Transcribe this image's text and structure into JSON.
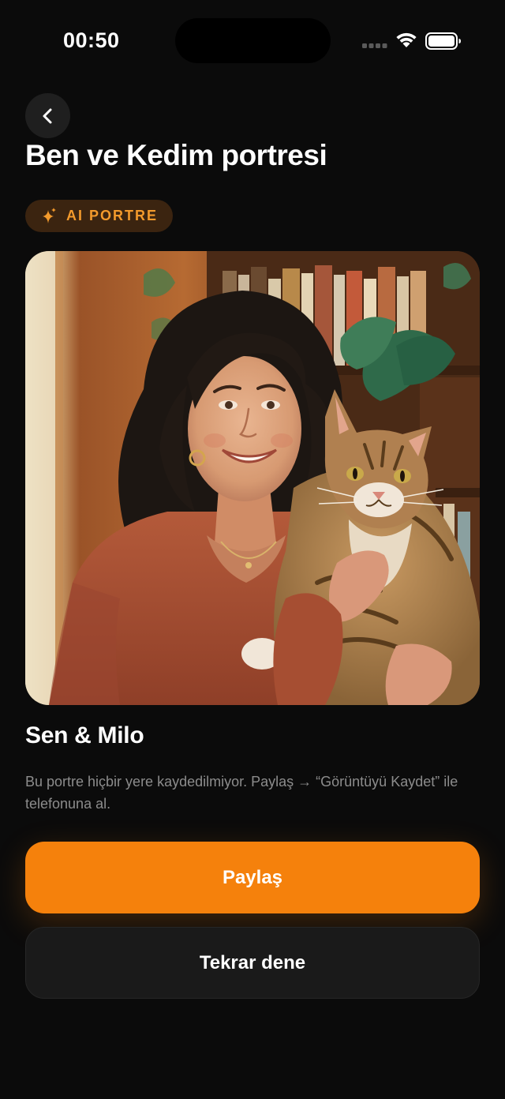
{
  "status_bar": {
    "time": "00:50",
    "icons": [
      "cellular-signal-icon",
      "wifi-icon",
      "battery-icon"
    ]
  },
  "header": {
    "back_icon": "chevron-left-icon",
    "title": "Ben ve Kedim portresi",
    "badge": {
      "icon": "sparkle-icon",
      "label": "AI PORTRE"
    }
  },
  "portrait": {
    "caption": "Sen & Milo",
    "note": "Bu portre hiçbir yere kaydedilmiyor. Paylaş → “Görüntüyü Kaydet” ile telefonuna al."
  },
  "actions": {
    "share_label": "Paylaş",
    "retry_label": "Tekrar dene"
  },
  "colors": {
    "background": "#0b0b0b",
    "accent": "#f5810c",
    "badge_bg": "#3b2410",
    "badge_text": "#f39a2c",
    "secondary_button": "#1a1a1a",
    "muted_text": "#8c8c8c"
  }
}
